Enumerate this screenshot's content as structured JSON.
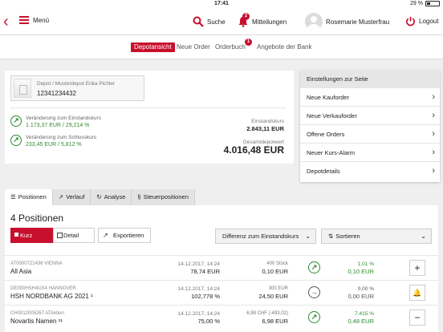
{
  "status": {
    "left": "",
    "time": "17:41",
    "battery": "29 %"
  },
  "nav": {
    "menu": "Menü",
    "search": "Suche",
    "messages": "Mitteilungen",
    "messages_badge": "2",
    "user": "Rosemarie Musterfrau",
    "logout": "Logout"
  },
  "subtabs": {
    "depot": "Depotansicht",
    "new_order": "Neue Order",
    "orderbook": "Orderbuch",
    "orderbook_badge": "1",
    "offers": "Angebote der Bank"
  },
  "depot": {
    "name": "Depot / Musterdepot Erika Pichler",
    "number": "12341234432",
    "perf1_label": "Veränderung zum Einstandskurs",
    "perf1_value": "1.173,37 EUR / 29,214 %",
    "perf2_label": "Veränderung zum Schlusskurs",
    "perf2_value": "233,45 EUR / 5,812 %",
    "kurs_label": "Einstandskurs",
    "kurs_value": "2.843,11 EUR",
    "total_label": "Gesamtdepotwert",
    "total_value": "4.016,48 EUR"
  },
  "settings": {
    "title": "Einstellungen zur Seite",
    "items": [
      "Neue Kauforder",
      "Neue Verkauforder",
      "Offene Orders",
      "Neuer Kurs-Alarm",
      "Depotdetails"
    ]
  },
  "tabs": [
    "Positionen",
    "Verlauf",
    "Analyse",
    "Steuerpositionen"
  ],
  "list": {
    "title": "4 Positionen",
    "kurz": "Kurz",
    "detail": "Detail",
    "export": "Exportieren",
    "sort_diff": "Differenz zum Einstandskurs",
    "sort": "Sortieren",
    "rows": [
      {
        "isin": "AT0000721436 VIENNA",
        "name": "All Asia",
        "date": "14.12.2017, 14:24",
        "price": "78,74 EUR",
        "qty": "400 Stück",
        "value": "0,10 EUR",
        "pct": "1,01 %",
        "abs": "0,10 EUR",
        "action": "+",
        "trend": "up"
      },
      {
        "isin": "DE000HSH4UX4 HANNOVER",
        "name": "HSH NORDBANK AG 2021 ¹",
        "date": "14.12.2017, 14:24",
        "price": "102,778 %",
        "qty": "300 EUR",
        "value": "24,50 EUR",
        "pct": "0,00 %",
        "abs": "0,00 EUR",
        "action": "🔔",
        "trend": "neutral"
      },
      {
        "isin": "CH0012005267 ATAktien",
        "name": "Novartis Namen ¹¹",
        "date": "14.12.2017, 14:24",
        "price": "75,00 %",
        "qty": "6,98 CHF (-493,02)",
        "value": "6,98 EUR",
        "pct": "7,415 %",
        "abs": "0,48 EUR",
        "action": "−",
        "trend": "up"
      }
    ]
  }
}
